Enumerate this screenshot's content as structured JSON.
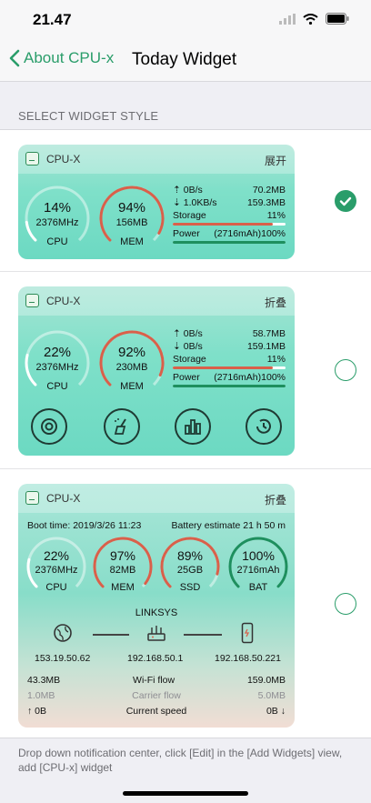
{
  "status": {
    "time": "21.47"
  },
  "nav": {
    "back_label": "About CPU-x",
    "title": "Today Widget"
  },
  "section_header": "SELECT WIDGET STYLE",
  "widgets": [
    {
      "name": "CPU-X",
      "action": "展开",
      "selected": true,
      "cpu": {
        "percent": "14%",
        "value": 0.14,
        "sub": "2376MHz",
        "label": "CPU"
      },
      "mem": {
        "percent": "94%",
        "value": 0.94,
        "sub": "156MB",
        "label": "MEM"
      },
      "up": {
        "rate": "0B/s",
        "total": "70.2MB"
      },
      "down": {
        "rate": "1.0KB/s",
        "total": "159.3MB"
      },
      "storage": {
        "label": "Storage",
        "pct": "11%",
        "value": 0.89
      },
      "power": {
        "label": "Power",
        "detail": "(2716mAh)100%",
        "value": 1.0
      }
    },
    {
      "name": "CPU-X",
      "action": "折叠",
      "selected": false,
      "cpu": {
        "percent": "22%",
        "value": 0.22,
        "sub": "2376MHz",
        "label": "CPU"
      },
      "mem": {
        "percent": "92%",
        "value": 0.92,
        "sub": "230MB",
        "label": "MEM"
      },
      "up": {
        "rate": "0B/s",
        "total": "58.7MB"
      },
      "down": {
        "rate": "0B/s",
        "total": "159.1MB"
      },
      "storage": {
        "label": "Storage",
        "pct": "11%",
        "value": 0.89
      },
      "power": {
        "label": "Power",
        "detail": "(2716mAh)100%",
        "value": 1.0
      },
      "tools": [
        "speed-icon",
        "clean-icon",
        "benchmark-icon",
        "history-icon"
      ]
    },
    {
      "name": "CPU-X",
      "action": "折叠",
      "selected": false,
      "boot_time": "Boot time: 2019/3/26 11:23",
      "battery_estimate": "Battery estimate 21 h 50 m",
      "gauges": [
        {
          "percent": "22%",
          "value": 0.22,
          "sub": "2376MHz",
          "label": "CPU",
          "color": "#ffffff"
        },
        {
          "percent": "97%",
          "value": 0.97,
          "sub": "82MB",
          "label": "MEM",
          "color": "#d9604a"
        },
        {
          "percent": "89%",
          "value": 0.89,
          "sub": "25GB",
          "label": "SSD",
          "color": "#d9604a"
        },
        {
          "percent": "100%",
          "value": 1.0,
          "sub": "2716mAh",
          "label": "BAT",
          "color": "#1e8f5e"
        }
      ],
      "network_name": "LINKSYS",
      "ips": [
        "153.19.50.62",
        "192.168.50.1",
        "192.168.50.221"
      ],
      "wifi_flow": {
        "left": "43.3MB",
        "label": "Wi-Fi flow",
        "right": "159.0MB"
      },
      "carrier_flow": {
        "left": "1.0MB",
        "label": "Carrier flow",
        "right": "5.0MB"
      },
      "speed": {
        "left": "0B",
        "label": "Current speed",
        "right": "0B"
      }
    }
  ],
  "footer": "Drop down notification center, click [Edit] in the [Add Widgets] view, add [CPU-x] widget",
  "colors": {
    "accent": "#2a9d6a",
    "mem_arc": "#d9604a",
    "storage_bar": "#d9604a",
    "power_bar": "#1e8f5e"
  }
}
